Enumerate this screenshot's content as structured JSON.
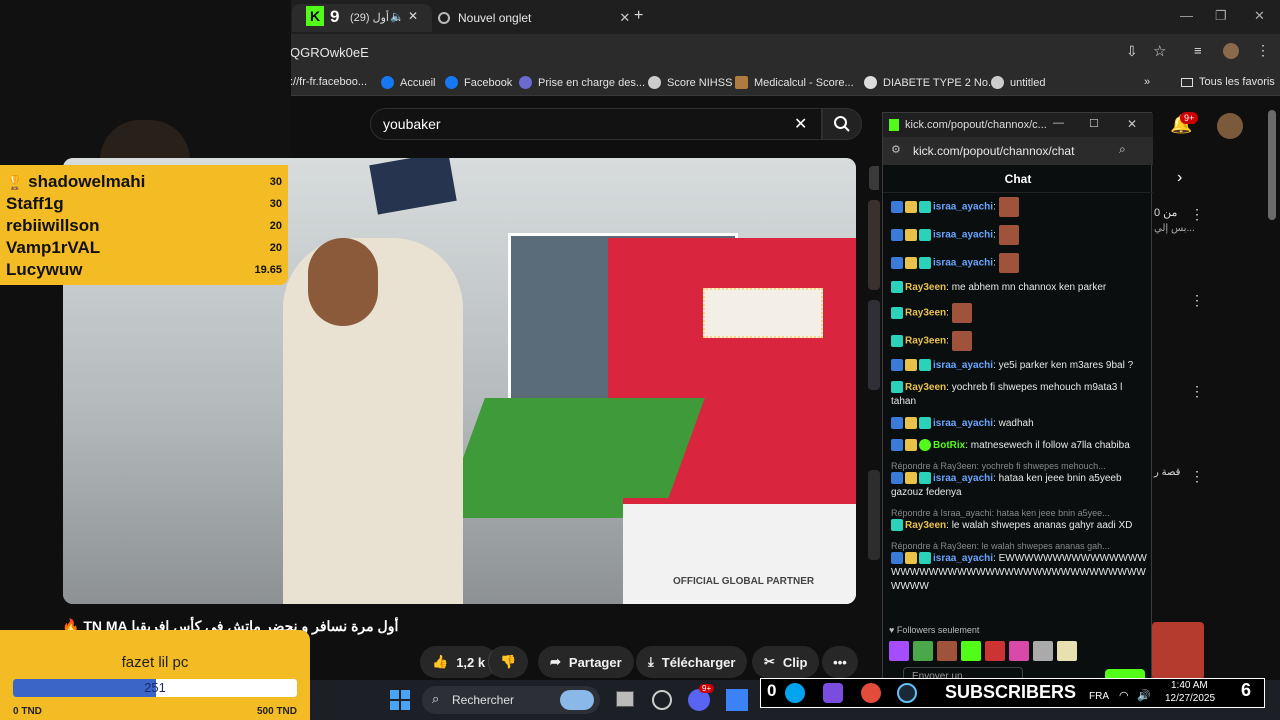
{
  "tabs": [
    {
      "label": "(29) أول ...",
      "badge": "9"
    },
    {
      "label": "Nouvel onglet"
    }
  ],
  "address": {
    "url_fragment": "QGROwk0eE"
  },
  "bookmarks": [
    "://fr-fr.faceboo...",
    "Accueil",
    "Facebook",
    "Prise en charge des...",
    "Score NIHSS",
    "Medicalcul - Score...",
    "DIABETE TYPE 2 No...",
    "untitled",
    "Tous les favoris"
  ],
  "youtube": {
    "search_value": "youbaker",
    "notifications": "9+",
    "video_title": "أول مرة نسافر و نحضر ماتش في كأس افريقيا TN MA 🔥",
    "likes": "1,2 k",
    "share": "Partager",
    "download": "Télécharger",
    "clip": "Clip",
    "watermark": "OFFICIAL GLOBAL PARTNER",
    "side_snippets": [
      "من 0",
      "بس إلي...",
      "قصة ر"
    ]
  },
  "leaderboard": [
    {
      "name": "shadowelmahi",
      "value": "30"
    },
    {
      "name": "Staff1g",
      "value": "30"
    },
    {
      "name": "rebiiwillson",
      "value": "20"
    },
    {
      "name": "Vamp1rVAL",
      "value": "20"
    },
    {
      "name": "Lucywuw",
      "value": "19.65"
    }
  ],
  "goal": {
    "title": "fazet lil pc",
    "current": "251",
    "progress": 0.502,
    "min": "0 TND",
    "max": "500 TND"
  },
  "popout": {
    "title": "kick.com/popout/channox/c...",
    "url": "kick.com/popout/channox/chat",
    "header": "Chat",
    "followers_only": "Followers seulement",
    "send_placeholder": "Envoyer un"
  },
  "chat": [
    {
      "user": "israa_ayachi",
      "text": ""
    },
    {
      "user": "israa_ayachi",
      "text": ""
    },
    {
      "user": "israa_ayachi",
      "text": ""
    },
    {
      "user": "Ray3een",
      "text": "me abhem mn channox ken parker"
    },
    {
      "user": "Ray3een",
      "text": ""
    },
    {
      "user": "Ray3een",
      "text": ""
    },
    {
      "user": "israa_ayachi",
      "text": "ye5i parker ken m3ares 9bal ?"
    },
    {
      "user": "Ray3een",
      "text": "yochreb fi shwepes mehouch m9ata3 l tahan"
    },
    {
      "user": "israa_ayachi",
      "text": "wadhah"
    },
    {
      "user": "BotRix",
      "text": "matnesewech il follow a7lla chabiba"
    },
    {
      "user": "israa_ayachi",
      "text": "hataa ken jeee bnin a5yeeb gazouz fedenya",
      "reply": "Répondre à Ray3een: yochreb fi shwepes mehouch..."
    },
    {
      "user": "Ray3een",
      "text": "le walah shwepes ananas gahyr aadi XD",
      "reply": "Répondre à Israa_ayachi: hataa ken jeee bnin a5yee..."
    },
    {
      "user": "israa_ayachi",
      "text": "EWWWWWWWWWWWWWWWWWWWWWWWWWWWWWWWWWWWWWWWWWWWWWW",
      "reply": "Répondre à Ray3een: le walah shwepes ananas gah..."
    }
  ],
  "taskbar": {
    "search": "Rechercher",
    "lang": "FRA",
    "time": "1:40 AM",
    "date": "12/27/2025",
    "badge_count": "9+",
    "subs_label": "SUBSCRIBERS",
    "subs_count_left": "0",
    "subs_count_right": "6"
  },
  "colors": {
    "overlay_yellow": "#f4bc24",
    "goal_blue": "#3b66c8",
    "kick_green": "#53fc18",
    "youtube_red": "#ff0000"
  }
}
